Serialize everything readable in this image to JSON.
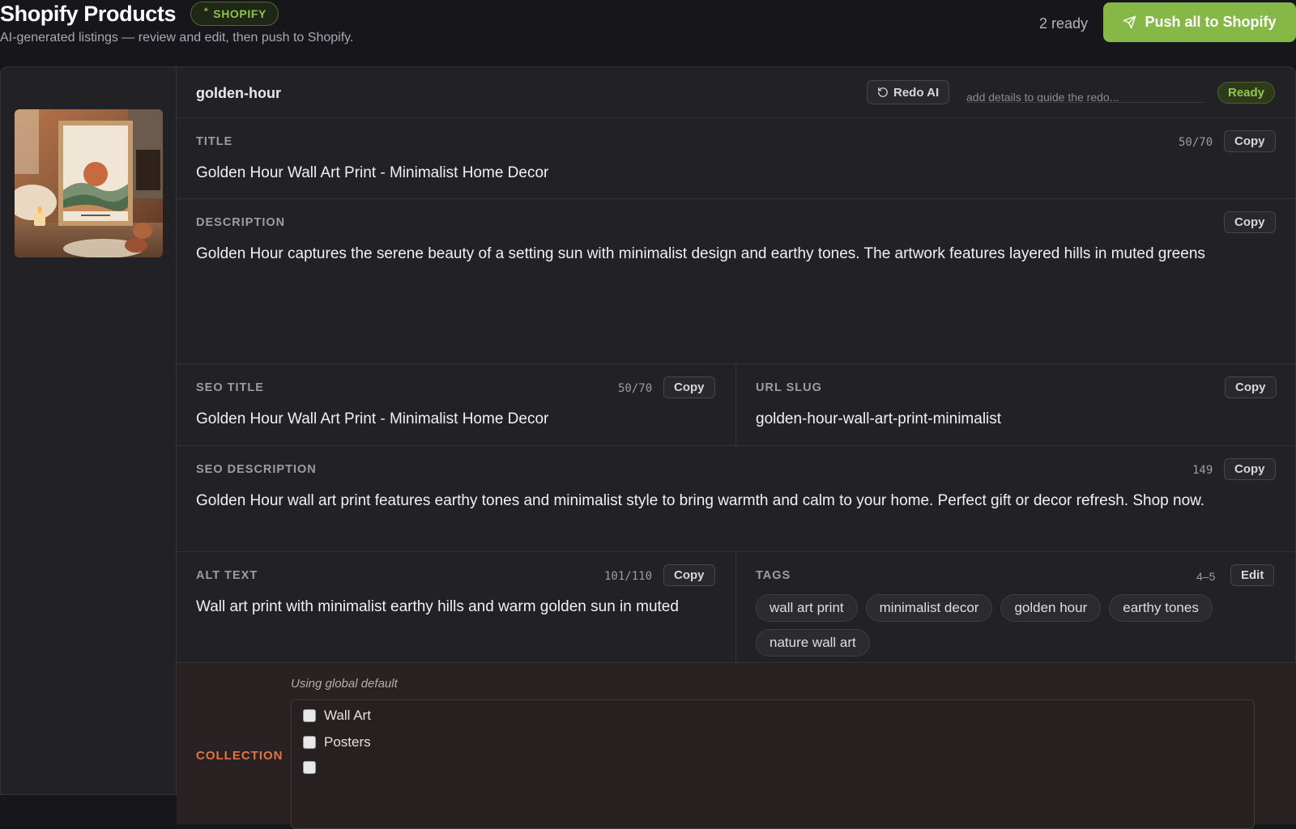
{
  "header": {
    "title": "Shopify Products",
    "badge": "SHOPIFY",
    "subtitle": "AI-generated listings — review and edit, then push to Shopify.",
    "ready_count": "2 ready",
    "push_button": "Push all to Shopify",
    "push_icon": "send-icon"
  },
  "product": {
    "name": "golden-hour",
    "redo_button": "Redo AI",
    "redo_icon": "rotate-ccw-icon",
    "redo_placeholder": "add details to guide the redo...",
    "status": "Ready",
    "status_color": "#94c650"
  },
  "fields": {
    "title": {
      "label": "TITLE",
      "count": "50/70",
      "copy": "Copy",
      "value": "Golden Hour Wall Art Print - Minimalist Home Decor"
    },
    "description": {
      "label": "DESCRIPTION",
      "copy": "Copy",
      "value": "Golden Hour captures the serene beauty of a setting sun with minimalist design and earthy tones. The artwork features layered hills in muted greens"
    },
    "seo_title": {
      "label": "SEO TITLE",
      "count": "50/70",
      "copy": "Copy",
      "value": "Golden Hour Wall Art Print - Minimalist Home Decor"
    },
    "url_slug": {
      "label": "URL SLUG",
      "copy": "Copy",
      "value": "golden-hour-wall-art-print-minimalist"
    },
    "seo_description": {
      "label": "SEO DESCRIPTION",
      "count": "149",
      "copy": "Copy",
      "value": "Golden Hour wall art print features earthy tones and minimalist style to bring warmth and calm to your home. Perfect gift or decor refresh. Shop now."
    },
    "alt_text": {
      "label": "ALT TEXT",
      "count": "101/110",
      "copy": "Copy",
      "value": "Wall art print with minimalist earthy hills and warm golden sun in muted"
    },
    "tags": {
      "label": "TAGS",
      "count": "4–5",
      "edit": "Edit",
      "items": [
        "wall art print",
        "minimalist decor",
        "golden hour",
        "earthy tones",
        "nature wall art"
      ]
    }
  },
  "collection": {
    "label": "COLLECTION",
    "note": "Using global default",
    "options": [
      {
        "label": "Wall Art",
        "checked": false
      },
      {
        "label": "Posters",
        "checked": false
      }
    ]
  },
  "colors": {
    "accent": "#86b848",
    "collection_label": "#e0763e",
    "background": "#17171b"
  }
}
